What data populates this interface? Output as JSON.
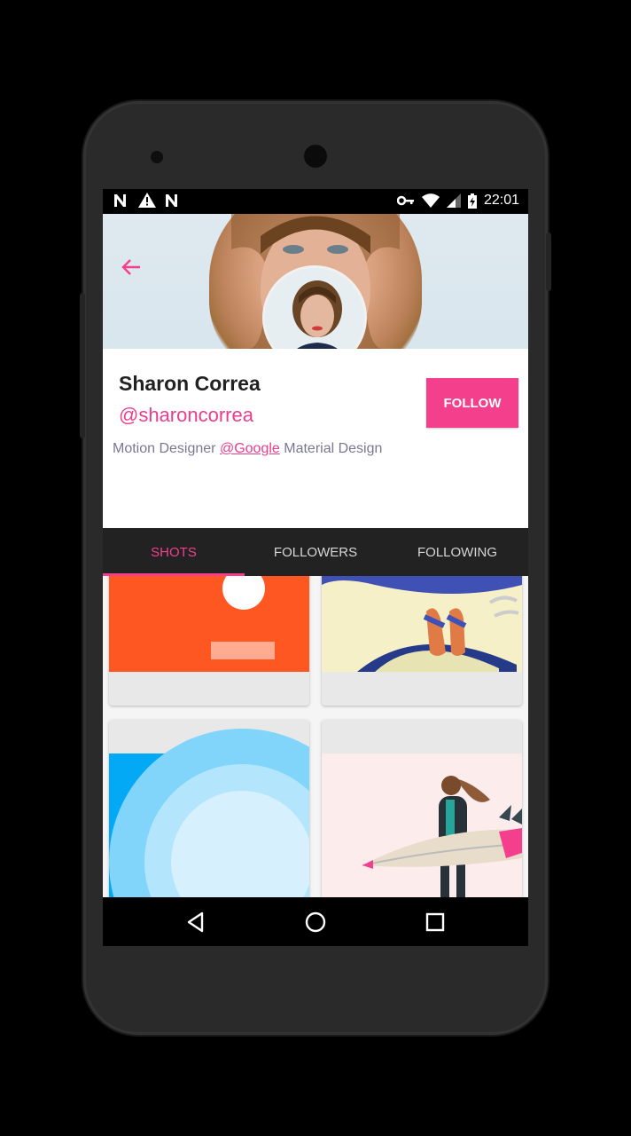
{
  "statusbar": {
    "left_icons": [
      "n-notification-icon",
      "warning-icon",
      "n-notification-icon"
    ],
    "right_icons": [
      "vpn-key-icon",
      "wifi-icon",
      "signal-icon",
      "battery-charging-icon"
    ],
    "time": "22:01"
  },
  "profile": {
    "name": "Sharon Correa",
    "handle": "@sharoncorrea",
    "bio_prefix": "Motion Designer ",
    "bio_link": "@Google",
    "bio_suffix": " Material Design",
    "follow_label": "FOLLOW"
  },
  "tabs": [
    {
      "label": "SHOTS",
      "active": true
    },
    {
      "label": "FOLLOWERS",
      "active": false
    },
    {
      "label": "FOLLOWING",
      "active": false
    }
  ],
  "colors": {
    "accent": "#f43f8c",
    "tab_bar": "#222222",
    "status_bar": "#000000"
  },
  "shots": [
    "orange-shot",
    "sandals-shot",
    "blue-circles-shot",
    "surfer-shot"
  ]
}
